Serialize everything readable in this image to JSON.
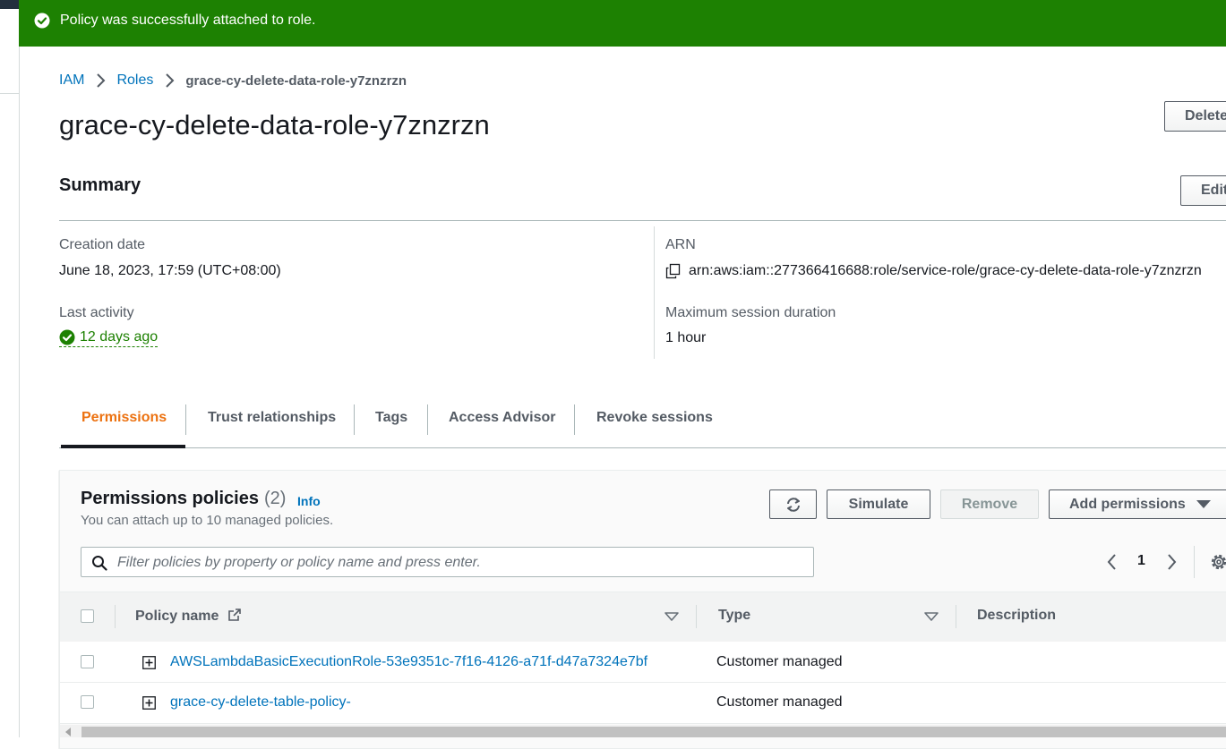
{
  "flash": {
    "message": "Policy was successfully attached to role."
  },
  "breadcrumb": {
    "items": [
      "IAM",
      "Roles"
    ],
    "current": "grace-cy-delete-data-role-y7znzrzn"
  },
  "page": {
    "title": "grace-cy-delete-data-role-y7znzrzn",
    "delete_label": "Delete"
  },
  "summary": {
    "title": "Summary",
    "edit_label": "Edit",
    "creation_date_label": "Creation date",
    "creation_date": "June 18, 2023, 17:59 (UTC+08:00)",
    "last_activity_label": "Last activity",
    "last_activity": "12 days ago",
    "arn_label": "ARN",
    "arn": "arn:aws:iam::277366416688:role/service-role/grace-cy-delete-data-role-y7znzrzn",
    "max_session_label": "Maximum session duration",
    "max_session": "1 hour"
  },
  "tabs": [
    "Permissions",
    "Trust relationships",
    "Tags",
    "Access Advisor",
    "Revoke sessions"
  ],
  "active_tab": "Permissions",
  "permissions": {
    "title": "Permissions policies",
    "count": "(2)",
    "info": "Info",
    "description": "You can attach up to 10 managed policies.",
    "simulate_label": "Simulate",
    "remove_label": "Remove",
    "add_label": "Add permissions",
    "search_placeholder": "Filter policies by property or policy name and press enter.",
    "page": "1",
    "columns": [
      "Policy name",
      "Type",
      "Description"
    ],
    "rows": [
      {
        "name": "AWSLambdaBasicExecutionRole-53e9351c-7f16-4126-a71f-d47a7324e7bf",
        "type": "Customer managed",
        "description": ""
      },
      {
        "name": "grace-cy-delete-table-policy-",
        "type": "Customer managed",
        "description": ""
      }
    ]
  },
  "colors": {
    "success": "#1d8102",
    "link": "#0073bb",
    "active_tab": "#ec7211",
    "header": "#232f3e"
  }
}
